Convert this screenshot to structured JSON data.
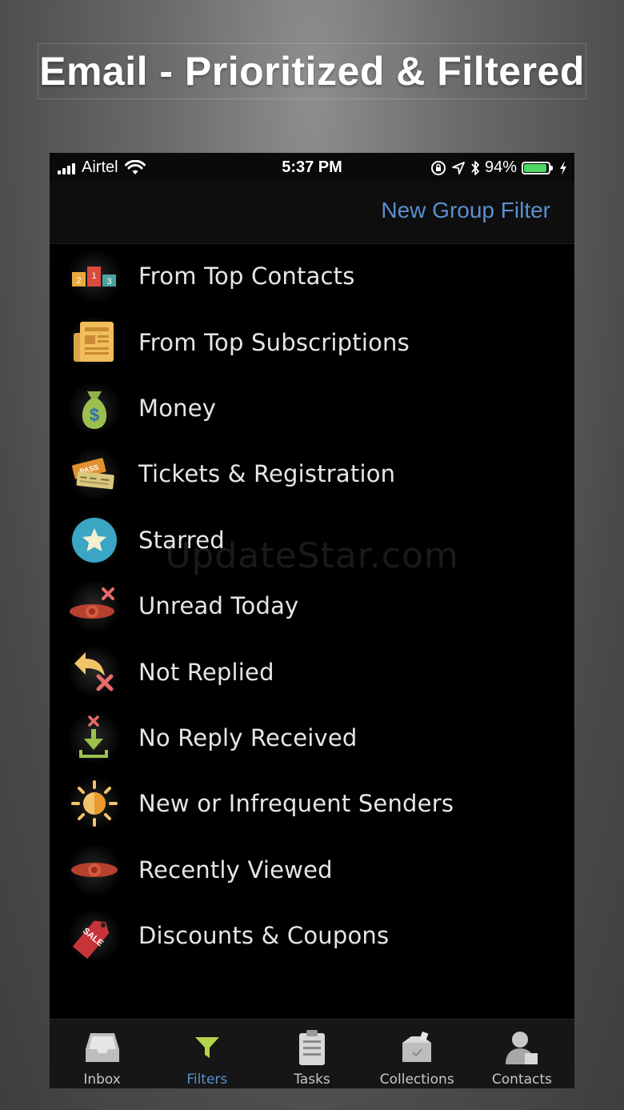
{
  "headline": "Email - Prioritized & Filtered",
  "status_bar": {
    "carrier": "Airtel",
    "time": "5:37 PM",
    "battery": "94%",
    "battery_level": 0.94
  },
  "nav": {
    "new_group_filter": "New Group Filter"
  },
  "filters": [
    {
      "label": "From Top Contacts",
      "icon": "podium-icon"
    },
    {
      "label": "From Top Subscriptions",
      "icon": "newspaper-icon"
    },
    {
      "label": "Money",
      "icon": "money-bag-icon"
    },
    {
      "label": "Tickets & Registration",
      "icon": "ticket-icon"
    },
    {
      "label": "Starred",
      "icon": "star-icon"
    },
    {
      "label": "Unread Today",
      "icon": "eye-x-icon"
    },
    {
      "label": "Not Replied",
      "icon": "reply-x-icon"
    },
    {
      "label": "No Reply Received",
      "icon": "download-x-icon"
    },
    {
      "label": "New or Infrequent Senders",
      "icon": "sun-icon"
    },
    {
      "label": "Recently Viewed",
      "icon": "eye-icon"
    },
    {
      "label": "Discounts & Coupons",
      "icon": "sale-tag-icon"
    }
  ],
  "icon_text": {
    "podium": [
      "2",
      "1",
      "3"
    ],
    "ticket": "PASS",
    "money": "$",
    "sale": "SALE"
  },
  "watermark": "UpdateStar.com",
  "tabs": [
    {
      "label": "Inbox",
      "icon": "inbox-icon",
      "active": false
    },
    {
      "label": "Filters",
      "icon": "filter-icon",
      "active": true
    },
    {
      "label": "Tasks",
      "icon": "clipboard-icon",
      "active": false
    },
    {
      "label": "Collections",
      "icon": "box-icon",
      "active": false
    },
    {
      "label": "Contacts",
      "icon": "person-icon",
      "active": false
    }
  ],
  "colors": {
    "accent": "#5b8fd0",
    "background": "#000000",
    "text": "#e6e6e6"
  }
}
